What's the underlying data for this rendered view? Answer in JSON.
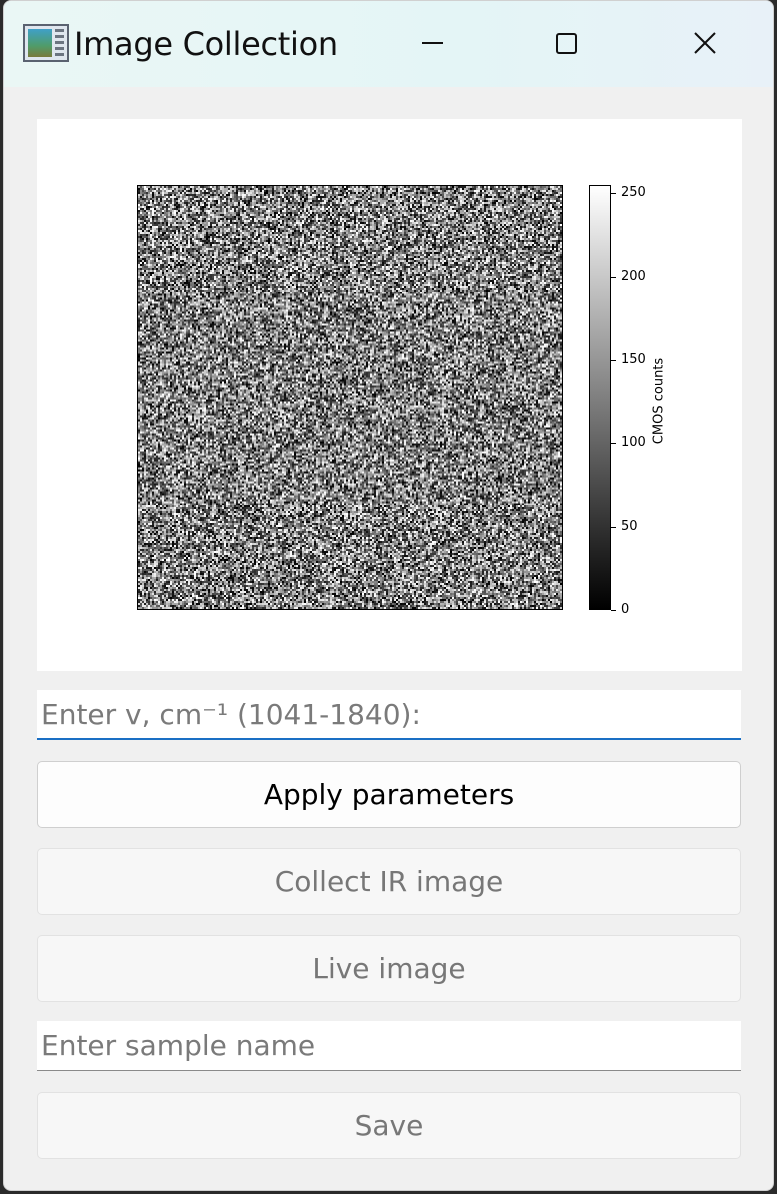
{
  "window": {
    "title": "Image Collection",
    "icons": {
      "app": "app-image-icon",
      "minimize": "minimize-icon",
      "maximize": "maximize-icon",
      "close": "close-icon"
    }
  },
  "chart_data": {
    "type": "heatmap",
    "colormap": "gray",
    "colorbar": {
      "label": "CMOS counts",
      "range": [
        0,
        255
      ],
      "ticks": [
        "0",
        "50",
        "100",
        "150",
        "200",
        "250"
      ]
    },
    "content": "random noise image",
    "grid": false
  },
  "controls": {
    "wavenumber_input": {
      "placeholder": "Enter v, cm⁻¹ (1041-1840):",
      "value": ""
    },
    "apply_button": {
      "label": "Apply parameters",
      "enabled": true
    },
    "collect_button": {
      "label": "Collect IR image",
      "enabled": false
    },
    "live_button": {
      "label": "Live image",
      "enabled": false
    },
    "sample_name_input": {
      "placeholder": "Enter sample name",
      "value": ""
    },
    "save_button": {
      "label": "Save",
      "enabled": false
    }
  },
  "colors": {
    "focus_accent": "#1a6fc4"
  }
}
